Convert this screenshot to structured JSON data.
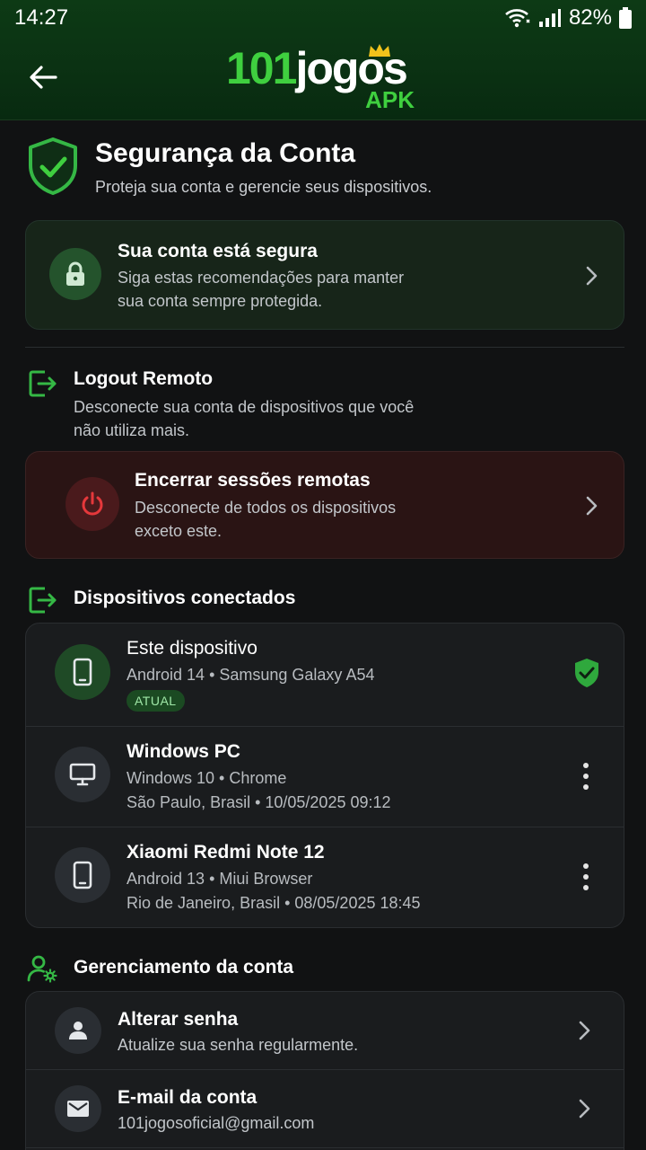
{
  "status": {
    "time": "14:27",
    "battery": "82%"
  },
  "header": {
    "logo_num": "101",
    "logo_word": "jogos",
    "logo_suffix": "APK"
  },
  "page": {
    "title": "Segurança da Conta",
    "subtitle": "Proteja sua conta e gerencie seus dispositivos."
  },
  "secure_card": {
    "title": "Sua conta está segura",
    "desc_line1": "Siga estas recomendações para manter",
    "desc_line2": "sua conta sempre protegida."
  },
  "remote_logout": {
    "title": "Logout Remoto",
    "desc_line1": "Desconecte sua conta de dispositivos que você",
    "desc_line2": "não utiliza mais.",
    "card_title": "Encerrar sessões remotas",
    "card_desc_line1": "Desconecte de todos os dispositivos",
    "card_desc_line2": "exceto este."
  },
  "devices": {
    "title": "Dispositivos conectados",
    "items": [
      {
        "name": "Este dispositivo",
        "line1": "Android 14 • Samsung Galaxy A54",
        "badge": "ATUAL",
        "icon": "smartphone-icon"
      },
      {
        "name": "Windows PC",
        "line1": "Windows 10 • Chrome",
        "line2": "São Paulo, Brasil • 10/05/2025 09:12",
        "icon": "desktop-icon"
      },
      {
        "name": "Xiaomi Redmi Note 12",
        "line1": "Android 13 • Miui Browser",
        "line2": "Rio de Janeiro, Brasil • 08/05/2025 18:45",
        "icon": "smartphone-icon"
      }
    ]
  },
  "account": {
    "title": "Gerenciamento da conta",
    "items": [
      {
        "title": "Alterar senha",
        "desc": "Atualize sua senha regularmente.",
        "icon": "person-icon"
      },
      {
        "title": "E-mail da conta",
        "desc": "101jogosoficial@gmail.com",
        "icon": "mail-icon"
      }
    ]
  },
  "colors": {
    "accent": "#3fcf3f",
    "danger": "#e5383b",
    "background": "#111213"
  }
}
